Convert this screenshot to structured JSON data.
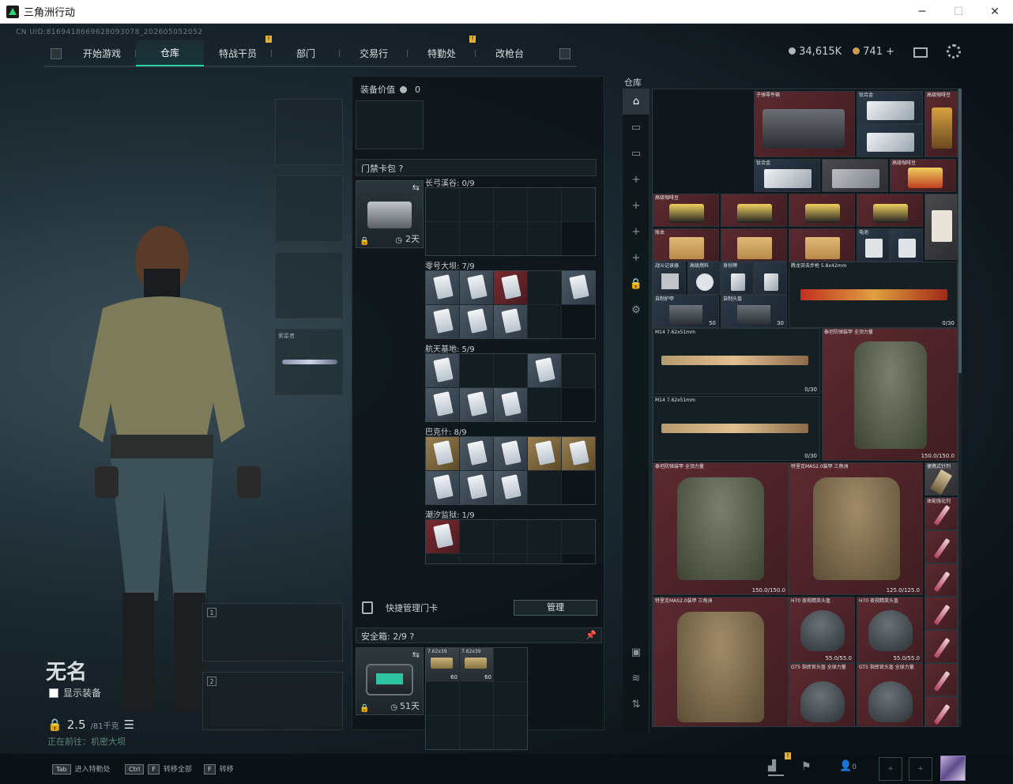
{
  "window": {
    "title": "三角洲行动",
    "min": "─",
    "max": "☐",
    "close": "✕"
  },
  "uid": "CN UID:8169418669628093078_202605052052",
  "nav": {
    "tabs": [
      {
        "label": "开始游戏",
        "badge": ""
      },
      {
        "label": "仓库",
        "badge": ""
      },
      {
        "label": "特战干员",
        "badge": "!"
      },
      {
        "label": "部门",
        "badge": ""
      },
      {
        "label": "交易行",
        "badge": ""
      },
      {
        "label": "特勤处",
        "badge": "!"
      },
      {
        "label": "改枪台",
        "badge": ""
      }
    ]
  },
  "currency": {
    "silver": "34,615K",
    "gold": "741 +"
  },
  "character": {
    "name": "无名",
    "show_equipment": "显示装备",
    "weight": "2.5",
    "weight_max": "/81千克",
    "location": "正在前往：机密大坝"
  },
  "gear_slots": {
    "melee_label": "紫星者"
  },
  "weapon_slots": [
    "1",
    "2"
  ],
  "bottom": [
    {
      "key": "Tab",
      "label": "进入特勤处"
    },
    {
      "key": "Ctrl",
      "key2": "F",
      "label": "转移全部"
    },
    {
      "key": "F",
      "label": "转移"
    }
  ],
  "bottom_right": {
    "badge": "!",
    "count": "0"
  },
  "middle": {
    "equip_value_label": "装备价值",
    "equip_value": "0",
    "keycard_bag": "门禁卡包",
    "keycase_time": "2天",
    "groups": [
      {
        "title": "长弓溪谷: 0/9"
      },
      {
        "title": "零号大坝: 7/9"
      },
      {
        "title": "航天基地: 5/9"
      },
      {
        "title": "巴克什: 8/9"
      },
      {
        "title": "潮汐监狱: 1/9"
      }
    ],
    "quick_manage": "快捷管理门卡",
    "manage_btn": "管理",
    "safe_title": "安全箱:",
    "safe_count": "2/9",
    "safe_time": "51天",
    "ammo": [
      {
        "t": "7.62x39",
        "n": "60"
      },
      {
        "t": "7.62x39",
        "n": "60"
      }
    ]
  },
  "stash": {
    "label": "仓库",
    "items": {
      "bullet_parts": "子弹零件箱",
      "alloy": "钛合金",
      "gpu": "高级咖啡豆",
      "tool": "高级咖啡豆",
      "ledger": "账本",
      "heater": "电池",
      "recorder": "战斗记录器",
      "fuel": "高级燃料",
      "tag": "身份牌",
      "ak": "腾龙突击步枪 5.8x42mm",
      "ak_n": "0/30",
      "armor_a": "自制护甲",
      "armor_a_n": "50",
      "helmet_a": "自制头盔",
      "helmet_a_n": "30",
      "m14": "M14 7.62x51mm",
      "m14_n": "0/30",
      "heavy": "泰坦防弹装甲 全顶力量",
      "heavy_n": "150.0/150.0",
      "vest1": "泰坦防弹装甲 全顶力量",
      "vest1_n": "150.0/150.0",
      "vest2": "特里克MAS2.0装甲 三角洲",
      "vest2_n": "125.0/125.0",
      "vest3": "特里克MAS2.0装甲 三角洲",
      "h70": "H70 夜视精英头盔",
      "h70_n": "55.0/55.0",
      "gt5": "GT5 指挥官头盔 全球力量",
      "syringe": "体能强化剂",
      "medkit": "便携式针剂"
    }
  }
}
